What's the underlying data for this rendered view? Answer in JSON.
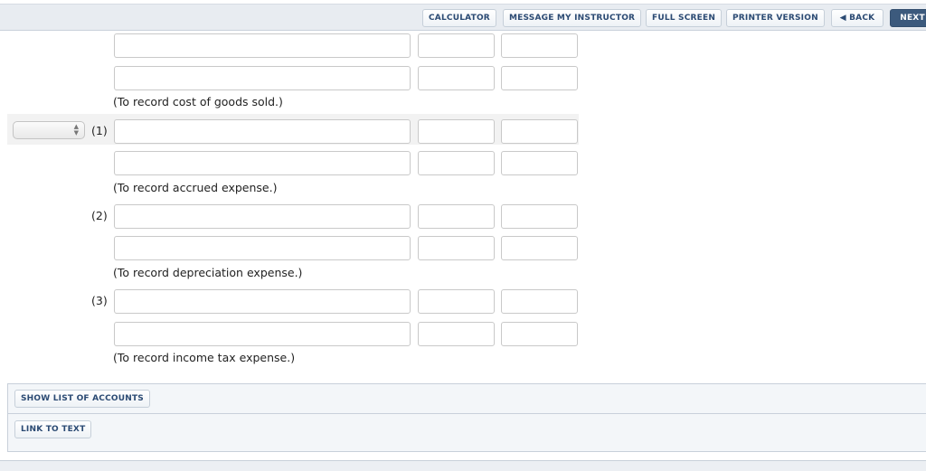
{
  "toolbar": {
    "calculator": "CALCULATOR",
    "message_instructor": "MESSAGE MY INSTRUCTOR",
    "full_screen": "FULL SCREEN",
    "printer_version": "PRINTER VERSION",
    "back": "BACK",
    "back_icon": "caret-left-icon",
    "next": "NEXT"
  },
  "journal": {
    "entries": [
      {
        "number": "",
        "note": "(To record cost of goods sold.)",
        "account_1": "",
        "debit_1": "",
        "credit_1": "",
        "account_2": "",
        "debit_2": "",
        "credit_2": ""
      },
      {
        "number": "(1)",
        "note": "(To record accrued expense.)",
        "account_1": "",
        "debit_1": "",
        "credit_1": "",
        "account_2": "",
        "debit_2": "",
        "credit_2": "",
        "select_value": ""
      },
      {
        "number": "(2)",
        "note": "(To record depreciation expense.)",
        "account_1": "",
        "debit_1": "",
        "credit_1": "",
        "account_2": "",
        "debit_2": "",
        "credit_2": ""
      },
      {
        "number": "(3)",
        "note": "(To record income tax expense.)",
        "account_1": "",
        "debit_1": "",
        "credit_1": "",
        "account_2": "",
        "debit_2": "",
        "credit_2": ""
      }
    ]
  },
  "panel": {
    "show_accounts": "SHOW LIST OF ACCOUNTS",
    "link_to_text": "LINK TO TEXT"
  }
}
